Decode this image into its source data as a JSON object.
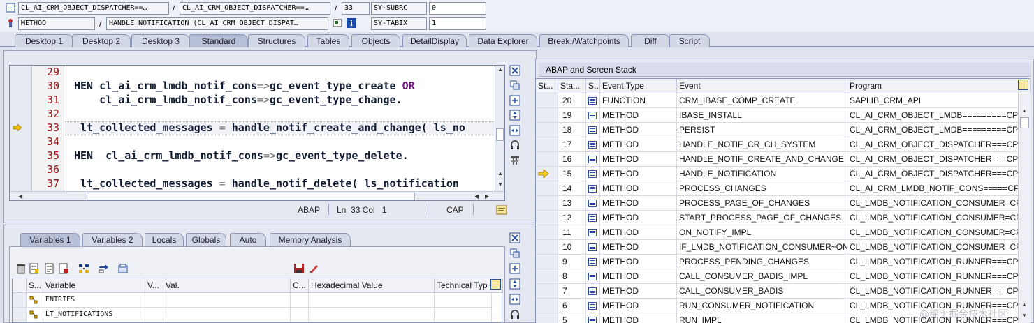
{
  "header": {
    "row1": {
      "field1": "CL_AI_CRM_OBJECT_DISPATCHER==…",
      "sep1": "/",
      "field2": "CL_AI_CRM_OBJECT_DISPATCHER==…",
      "sep2": "/",
      "line": "33",
      "var": "SY-SUBRC",
      "val": "0"
    },
    "row2": {
      "field1": "METHOD",
      "sep1": "/",
      "field2": "HANDLE_NOTIFICATION (CL_AI_CRM_OBJECT_DISPAT…",
      "var": "SY-TABIX",
      "val": "1"
    }
  },
  "tabs": [
    "Desktop 1",
    "Desktop 2",
    "Desktop 3",
    "Standard",
    "Structures",
    "Tables",
    "Objects",
    "DetailDisplay",
    "Data Explorer",
    "Break./Watchpoints",
    "Diff",
    "Script"
  ],
  "active_tab": "Standard",
  "code": {
    "lines": [
      {
        "num": "29",
        "text": ""
      },
      {
        "num": "30",
        "parts": [
          [
            "HEN cl_ai_crm_lmdb_notif_cons",
            ""
          ],
          [
            "=>",
            "op"
          ],
          [
            "gc_event_type_create ",
            ""
          ],
          [
            "OR",
            "kw"
          ]
        ]
      },
      {
        "num": "31",
        "parts": [
          [
            "    cl_ai_crm_lmdb_notif_cons",
            ""
          ],
          [
            "=>",
            "op"
          ],
          [
            "gc_event_type_change.",
            ""
          ]
        ]
      },
      {
        "num": "32",
        "text": ""
      },
      {
        "num": "33",
        "parts": [
          [
            " lt_collected_messages ",
            ""
          ],
          [
            "=",
            "op"
          ],
          [
            " handle_notif_create_and_change( ls_no",
            ""
          ]
        ]
      },
      {
        "num": "34",
        "text": ""
      },
      {
        "num": "35",
        "parts": [
          [
            "HEN  cl_ai_crm_lmdb_notif_cons",
            ""
          ],
          [
            "=>",
            "op"
          ],
          [
            "gc_event_type_delete.",
            ""
          ]
        ]
      },
      {
        "num": "36",
        "text": ""
      },
      {
        "num": "37",
        "parts": [
          [
            " lt_collected_messages ",
            ""
          ],
          [
            "=",
            "op"
          ],
          [
            " handle_notif_delete( ls_notification",
            ""
          ]
        ]
      }
    ],
    "status": {
      "lang": "ABAP",
      "pos": "Ln  33 Col   1",
      "caps": "CAP"
    }
  },
  "vartabs": [
    "Variables 1",
    "Variables 2",
    "Locals",
    "Globals",
    "Auto",
    "Memory Analysis"
  ],
  "vartable": {
    "columns": [
      "S...",
      "Variable",
      "V...",
      "Val.",
      "C...",
      "Hexadecimal Value",
      "Technical Typ"
    ],
    "rows": [
      {
        "name": "ENTRIES"
      },
      {
        "name": "LT_NOTIFICATIONS"
      }
    ]
  },
  "stack": {
    "title": "ABAP and Screen Stack",
    "columns": [
      "St...",
      "Sta...",
      "S...",
      "Event Type",
      "Event",
      "Program"
    ],
    "rows": [
      {
        "level": "20",
        "type": "FUNCTION",
        "event": "CRM_IBASE_COMP_CREATE",
        "program": "SAPLIB_CRM_API",
        "current": false
      },
      {
        "level": "19",
        "type": "METHOD",
        "event": "IBASE_INSTALL",
        "program": "CL_AI_CRM_OBJECT_LMDB=========CP",
        "current": false
      },
      {
        "level": "18",
        "type": "METHOD",
        "event": "PERSIST",
        "program": "CL_AI_CRM_OBJECT_LMDB=========CP",
        "current": false
      },
      {
        "level": "17",
        "type": "METHOD",
        "event": "HANDLE_NOTIF_CR_CH_SYSTEM",
        "program": "CL_AI_CRM_OBJECT_DISPATCHER===CP",
        "current": false
      },
      {
        "level": "16",
        "type": "METHOD",
        "event": "HANDLE_NOTIF_CREATE_AND_CHANGE",
        "program": "CL_AI_CRM_OBJECT_DISPATCHER===CP",
        "current": false
      },
      {
        "level": "15",
        "type": "METHOD",
        "event": "HANDLE_NOTIFICATION",
        "program": "CL_AI_CRM_OBJECT_DISPATCHER===CP",
        "current": true
      },
      {
        "level": "14",
        "type": "METHOD",
        "event": "PROCESS_CHANGES",
        "program": "CL_AI_CRM_LMDB_NOTIF_CONS=====CP",
        "current": false
      },
      {
        "level": "13",
        "type": "METHOD",
        "event": "PROCESS_PAGE_OF_CHANGES",
        "program": "CL_LMDB_NOTIFICATION_CONSUMER=CP",
        "current": false
      },
      {
        "level": "12",
        "type": "METHOD",
        "event": "START_PROCESS_PAGE_OF_CHANGES",
        "program": "CL_LMDB_NOTIFICATION_CONSUMER=CP",
        "current": false
      },
      {
        "level": "11",
        "type": "METHOD",
        "event": "ON_NOTIFY_IMPL",
        "program": "CL_LMDB_NOTIFICATION_CONSUMER=CP",
        "current": false
      },
      {
        "level": "10",
        "type": "METHOD",
        "event": "IF_LMDB_NOTIFICATION_CONSUMER~ON...",
        "program": "CL_LMDB_NOTIFICATION_CONSUMER=CP",
        "current": false
      },
      {
        "level": "9",
        "type": "METHOD",
        "event": "PROCESS_PENDING_CHANGES",
        "program": "CL_LMDB_NOTIFICATION_RUNNER===CP",
        "current": false
      },
      {
        "level": "8",
        "type": "METHOD",
        "event": "CALL_CONSUMER_BADIS_IMPL",
        "program": "CL_LMDB_NOTIFICATION_RUNNER===CP",
        "current": false
      },
      {
        "level": "7",
        "type": "METHOD",
        "event": "CALL_CONSUMER_BADIS",
        "program": "CL_LMDB_NOTIFICATION_RUNNER===CP",
        "current": false
      },
      {
        "level": "6",
        "type": "METHOD",
        "event": "RUN_CONSUMER_NOTIFICATION",
        "program": "CL_LMDB_NOTIFICATION_RUNNER===CP",
        "current": false
      },
      {
        "level": "5",
        "type": "METHOD",
        "event": "RUN_IMPL",
        "program": "CL_LMDB_NOTIFICATION_RUNNER===CP",
        "current": false
      }
    ]
  },
  "watermark": "@稀土掘金技术社区"
}
